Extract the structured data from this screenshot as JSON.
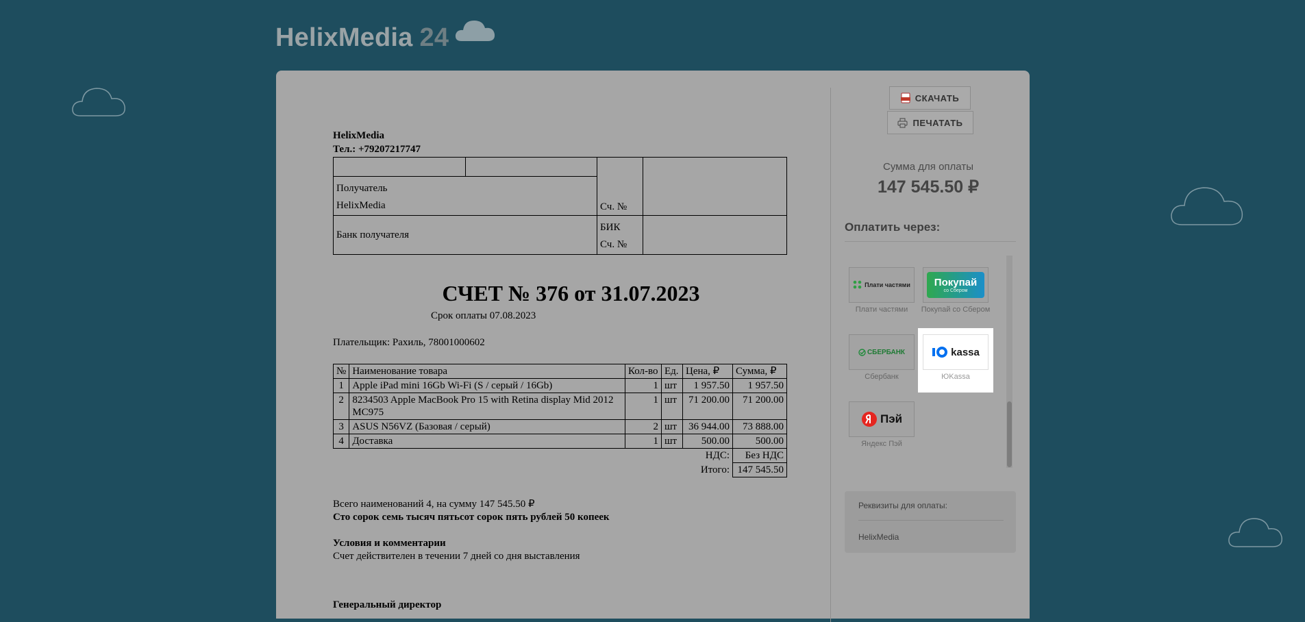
{
  "brand": {
    "name": "HelixMedia",
    "number": "24"
  },
  "toolbar": {
    "download_label": "СКАЧАТЬ",
    "print_label": "ПЕЧАТАТЬ"
  },
  "summary": {
    "label": "Сумма для оплаты",
    "value": "147 545.50 ₽"
  },
  "payment": {
    "heading": "Оплатить через:",
    "methods": [
      {
        "label": "Плати частями",
        "logo_text": "Плати частями"
      },
      {
        "label": "Покупай со Сбером",
        "logo_text": "Покупай",
        "logo_subtext": "со Сбером"
      },
      {
        "label": "Сбербанк",
        "logo_text": "СБЕРБАНК"
      },
      {
        "label": "ЮKassa",
        "logo_text": "kassa"
      },
      {
        "label": "Яндекс Пэй",
        "logo_text": "Пэй"
      }
    ],
    "active_method": "ЮKassa"
  },
  "requisites": {
    "title": "Реквизиты для оплаты:",
    "name": "HelixMedia"
  },
  "invoice": {
    "company": "HelixMedia",
    "phone": "Тел.: +79207217747",
    "recipient_label": "Получатель",
    "recipient_name": "HelixMedia",
    "account_label": "Сч. №",
    "bank_label": "Банк получателя",
    "bik_label": "БИК",
    "title": "СЧЕТ № 376 от 31.07.2023",
    "due": "Срок оплаты 07.08.2023",
    "payer": "Плательщик: Рахиль, 78001000602",
    "headers": [
      "№",
      "Наименование товара",
      "Кол-во",
      "Ед.",
      "Цена, ₽",
      "Сумма, ₽"
    ],
    "rows": [
      [
        "1",
        "Apple iPad mini 16Gb Wi-Fi (S / серый / 16Gb)",
        "1",
        "шт",
        "1 957.50",
        "1 957.50"
      ],
      [
        "2",
        "8234503 Apple MacBook Pro 15 with Retina display Mid 2012 MC975",
        "1",
        "шт",
        "71 200.00",
        "71 200.00"
      ],
      [
        "3",
        "ASUS N56VZ (Базовая / серый)",
        "2",
        "шт",
        "36 944.00",
        "73 888.00"
      ],
      [
        "4",
        "Доставка",
        "1",
        "шт",
        "500.00",
        "500.00"
      ]
    ],
    "vat_label": "НДС:",
    "vat_value": "Без НДС",
    "total_label": "Итого:",
    "total_value": "147 545.50",
    "summary_line": "Всего наименований 4, на сумму 147 545.50 ₽",
    "amount_words": "Сто сорок семь тысяч пятьсот сорок пять рублей 50 копеек",
    "conditions_title": "Условия и комментарии",
    "conditions_text": "Счет действителен в течении 7 дней со дня выставления",
    "director_label": "Генеральный директор"
  }
}
